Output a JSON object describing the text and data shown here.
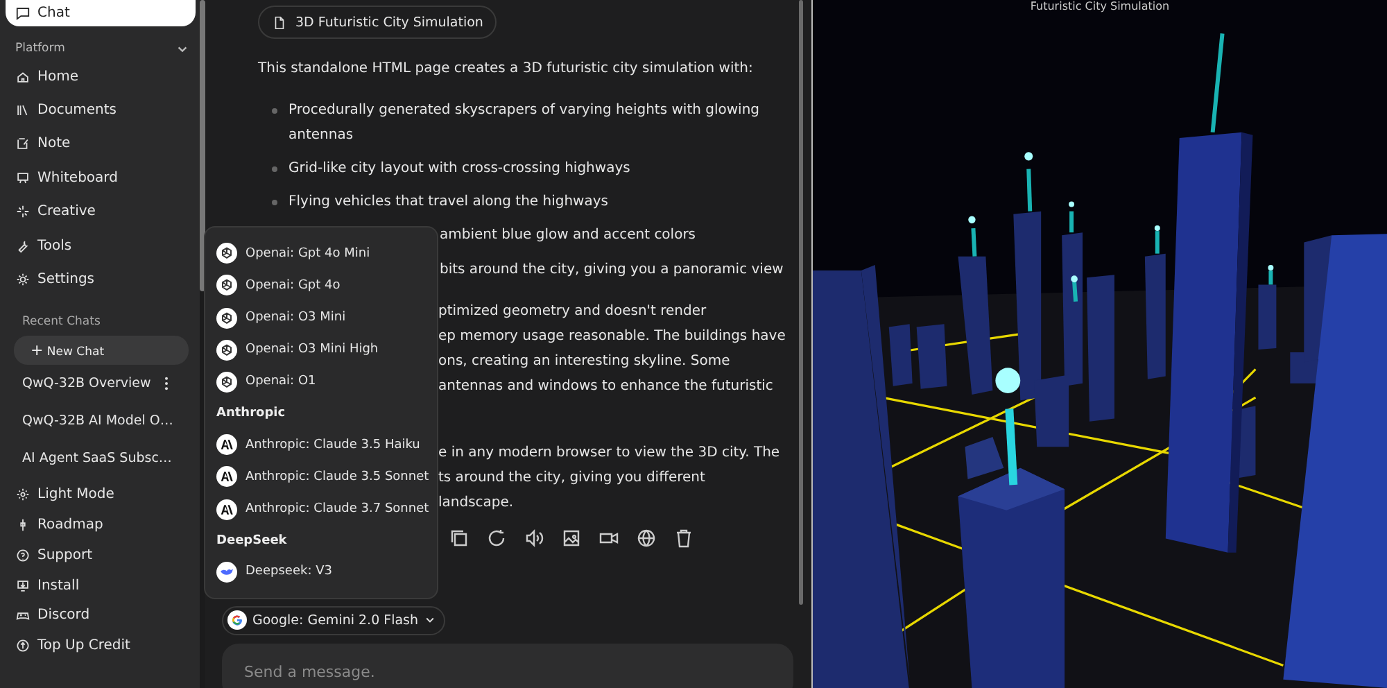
{
  "sidebar": {
    "chat_button": "Chat",
    "section": {
      "label": "Platform",
      "expanded": true
    },
    "nav": [
      {
        "label": "Home",
        "kind": "home"
      },
      {
        "label": "Documents",
        "kind": "library"
      },
      {
        "label": "Note",
        "kind": "note"
      },
      {
        "label": "Whiteboard",
        "kind": "board"
      },
      {
        "label": "Creative",
        "kind": "sparkle"
      },
      {
        "label": "Tools",
        "kind": "wrench"
      },
      {
        "label": "Settings",
        "kind": "gear"
      }
    ],
    "recent_heading": "Recent Chats",
    "new_chat": {
      "icon": "+",
      "label": "New Chat"
    },
    "recent": [
      "QwQ-32B Overview",
      "QwQ-32B AI Model O…",
      "AI Agent SaaS Subsc…"
    ],
    "footer": [
      {
        "label": "Light Mode",
        "kind": "sun"
      },
      {
        "label": "Roadmap",
        "kind": "milestone"
      },
      {
        "label": "Support",
        "kind": "help"
      },
      {
        "label": "Install",
        "kind": "install"
      },
      {
        "label": "Discord",
        "kind": "gamepad"
      },
      {
        "label": "Top Up Credit",
        "kind": "coin"
      }
    ]
  },
  "chat": {
    "file_chip": "3D Futuristic City Simulation",
    "intro": "This standalone HTML page creates a 3D futuristic city simulation with:",
    "bullets": [
      {
        "kind": "full",
        "text": "Procedurally generated skyscrapers of varying heights with glowing antennas"
      },
      {
        "kind": "full",
        "text": "Grid-like city layout with cross-crossing highways"
      },
      {
        "kind": "full",
        "text": "Flying vehicles that travel along the highways"
      },
      {
        "kind": "partial",
        "text": "ambient blue glow and accent colors"
      },
      {
        "kind": "partial",
        "text": "bits around the city, giving you a panoramic view"
      }
    ],
    "paragraphs": [
      [
        "ptimized geometry and doesn't render",
        "ep memory usage reasonable. The buildings have",
        "ons, creating an interesting skyline. Some",
        "antennas and windows to enhance the futuristic"
      ],
      [
        "e in any modern browser to view the 3D city. The",
        "ts around the city, giving you different",
        "landscape."
      ]
    ]
  },
  "model_menu": [
    {
      "kind": "openai",
      "label": "Openai: Gpt 4o Mini"
    },
    {
      "kind": "openai",
      "label": "Openai: Gpt 4o"
    },
    {
      "kind": "openai",
      "label": "Openai: O3 Mini"
    },
    {
      "kind": "openai",
      "label": "Openai: O3 Mini High"
    },
    {
      "kind": "openai",
      "label": "Openai: O1"
    },
    {
      "kind": "heading",
      "label": "Anthropic"
    },
    {
      "kind": "anthropic",
      "label": "Anthropic: Claude 3.5 Haiku"
    },
    {
      "kind": "anthropic",
      "label": "Anthropic: Claude 3.5 Sonnet"
    },
    {
      "kind": "anthropic",
      "label": "Anthropic: Claude 3.7 Sonnet"
    },
    {
      "kind": "heading",
      "label": "DeepSeek"
    },
    {
      "kind": "deepseek",
      "label": "Deepseek: V3"
    }
  ],
  "model_selector": {
    "label": "Google: Gemini 2.0 Flash"
  },
  "composer": {
    "placeholder": "Send a message."
  },
  "preview": {
    "title": "Futuristic City Simulation"
  }
}
